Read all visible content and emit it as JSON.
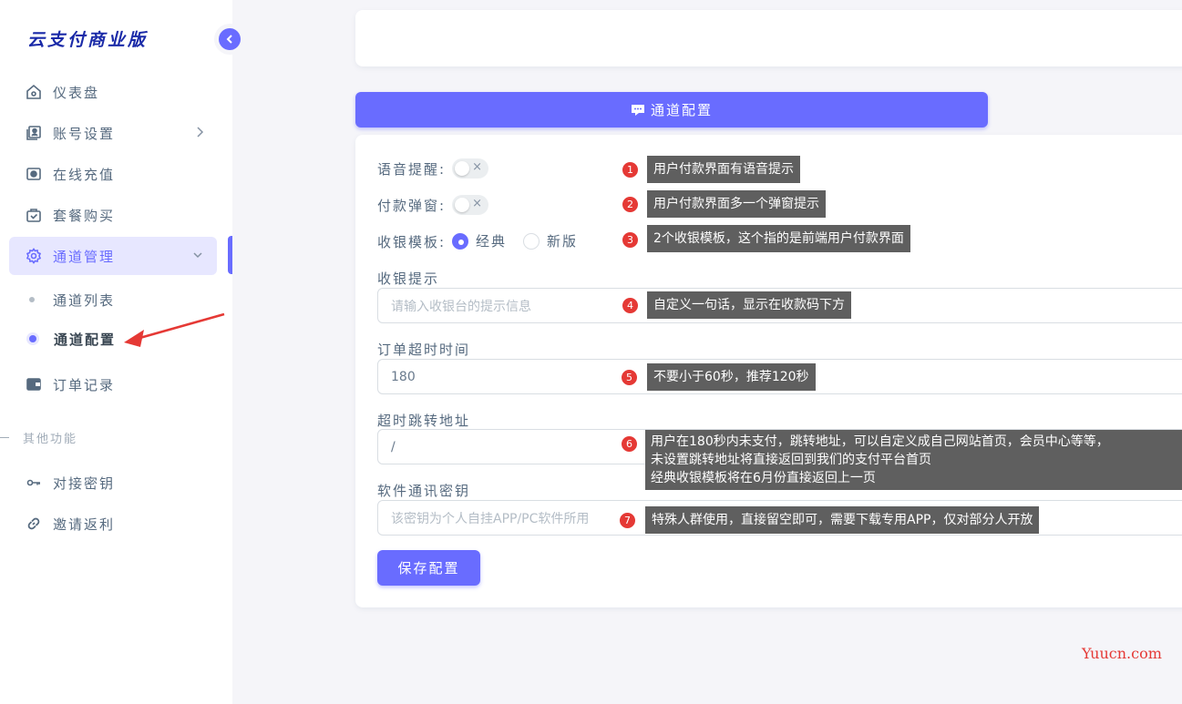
{
  "app": {
    "logo": "云支付商业版"
  },
  "sidebar": {
    "items": [
      {
        "label": "仪表盘",
        "icon": "home-icon"
      },
      {
        "label": "账号设置",
        "icon": "account-icon"
      },
      {
        "label": "在线充值",
        "icon": "camera-icon"
      },
      {
        "label": "套餐购买",
        "icon": "shopping-bag-icon"
      },
      {
        "label": "通道管理",
        "icon": "gear-icon"
      },
      {
        "label": "订单记录",
        "icon": "wallet-icon"
      }
    ],
    "subitems": [
      {
        "label": "通道列表"
      },
      {
        "label": "通道配置"
      }
    ],
    "section_label": "其他功能",
    "other_items": [
      {
        "label": "对接密钥",
        "icon": "key-icon"
      },
      {
        "label": "邀请返利",
        "icon": "link-icon"
      }
    ]
  },
  "header": {
    "title": "通道配置"
  },
  "form": {
    "voice_label": "语音提醒:",
    "popup_label": "付款弹窗:",
    "template_label": "收银模板:",
    "template_options": [
      "经典",
      "新版"
    ],
    "tip_label": "收银提示",
    "tip_placeholder": "请输入收银台的提示信息",
    "timeout_label": "订单超时时间",
    "timeout_value": "180",
    "redirect_label": "超时跳转地址",
    "redirect_value": "/",
    "secret_label": "软件通讯密钥",
    "secret_placeholder": "该密钥为个人自挂APP/PC软件所用",
    "save_label": "保存配置",
    "switch_off": "×"
  },
  "annotations": [
    {
      "num": "1",
      "text": "用户付款界面有语音提示"
    },
    {
      "num": "2",
      "text": "用户付款界面多一个弹窗提示"
    },
    {
      "num": "3",
      "text": "2个收银模板，这个指的是前端用户付款界面"
    },
    {
      "num": "4",
      "text": "自定义一句话，显示在收款码下方"
    },
    {
      "num": "5",
      "text": "不要小于60秒，推荐120秒"
    },
    {
      "num": "6",
      "lines": [
        "用户在180秒内未支付，跳转地址，可以自定义成自己网站首页，会员中心等等，",
        "未设置跳转地址将直接返回到我们的支付平台首页",
        "经典收银模板将在6月份直接返回上一页"
      ]
    },
    {
      "num": "7",
      "text": "特殊人群使用，直接留空即可，需要下载专用APP，仅对部分人开放"
    }
  ],
  "watermark": "Yuucn.com",
  "colors": {
    "accent": "#696cff",
    "badge": "#e53935",
    "note_bg": "#5f5f5f"
  }
}
